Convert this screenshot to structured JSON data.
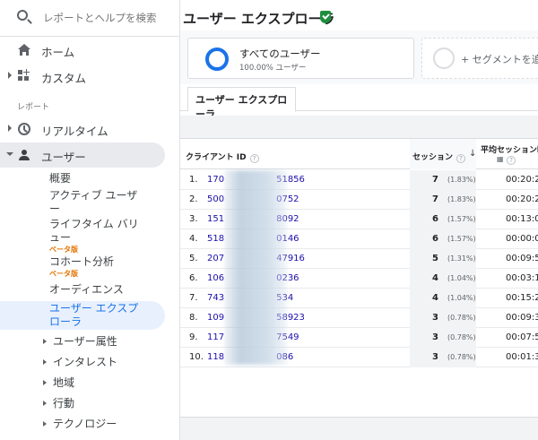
{
  "sidebar": {
    "search_placeholder": "レポートとヘルプを検索",
    "home": "ホーム",
    "custom": "カスタム",
    "reports_section": "レポート",
    "realtime": "リアルタイム",
    "users": "ユーザー",
    "sub_items": {
      "overview": "概要",
      "active_users_1": "アクティブ ユーザ",
      "active_users_2": "ー",
      "lifetime_1": "ライフタイム バリ",
      "lifetime_2": "ュー",
      "lifetime_beta": "ベータ版",
      "cohort": "コホート分析",
      "cohort_beta": "ベータ版",
      "audience": "オーディエンス",
      "explorer_1": "ユーザー エクスプ",
      "explorer_2": "ローラ"
    },
    "groups": [
      "ユーザー属性",
      "インタレスト",
      "地域",
      "行動",
      "テクノロジー"
    ]
  },
  "header": {
    "title": "ユーザー エクスプローラ"
  },
  "segment": {
    "name": "すべてのユーザー",
    "pct": "100.00% ユーザー",
    "add": "+ セグメントを追加"
  },
  "tabs": {
    "active": "ユーザー エクスプローラ"
  },
  "table": {
    "col_client": "クライアント ID",
    "col_sessions": "セッション",
    "col_avg": "平均セッション時",
    "rows": [
      {
        "n": "1.",
        "id": "170",
        "id_tail": "51856",
        "s": "7",
        "p": "(1.83%)",
        "a": "00:20:2"
      },
      {
        "n": "2.",
        "id": "500",
        "id_tail": "0752",
        "s": "7",
        "p": "(1.83%)",
        "a": "00:20:2"
      },
      {
        "n": "3.",
        "id": "151",
        "id_tail": "8092",
        "s": "6",
        "p": "(1.57%)",
        "a": "00:13:0"
      },
      {
        "n": "4.",
        "id": "518",
        "id_tail": "0146",
        "s": "6",
        "p": "(1.57%)",
        "a": "00:00:0"
      },
      {
        "n": "5.",
        "id": "207",
        "id_tail": "47916",
        "s": "5",
        "p": "(1.31%)",
        "a": "00:09:5"
      },
      {
        "n": "6.",
        "id": "106",
        "id_tail": "0236",
        "s": "4",
        "p": "(1.04%)",
        "a": "00:03:1"
      },
      {
        "n": "7.",
        "id": "743",
        "id_tail": "534",
        "s": "4",
        "p": "(1.04%)",
        "a": "00:15:2"
      },
      {
        "n": "8.",
        "id": "109",
        "id_tail": "58923",
        "s": "3",
        "p": "(0.78%)",
        "a": "00:09:3"
      },
      {
        "n": "9.",
        "id": "117",
        "id_tail": "7549",
        "s": "3",
        "p": "(0.78%)",
        "a": "00:07:5"
      },
      {
        "n": "10.",
        "id": "118",
        "id_tail": "086",
        "s": "3",
        "p": "(0.78%)",
        "a": "00:01:3"
      }
    ]
  },
  "colors": {
    "accent": "#1a73e8",
    "link": "#1a0dab",
    "beta": "#e37400",
    "verified": "#1e8e3e"
  }
}
